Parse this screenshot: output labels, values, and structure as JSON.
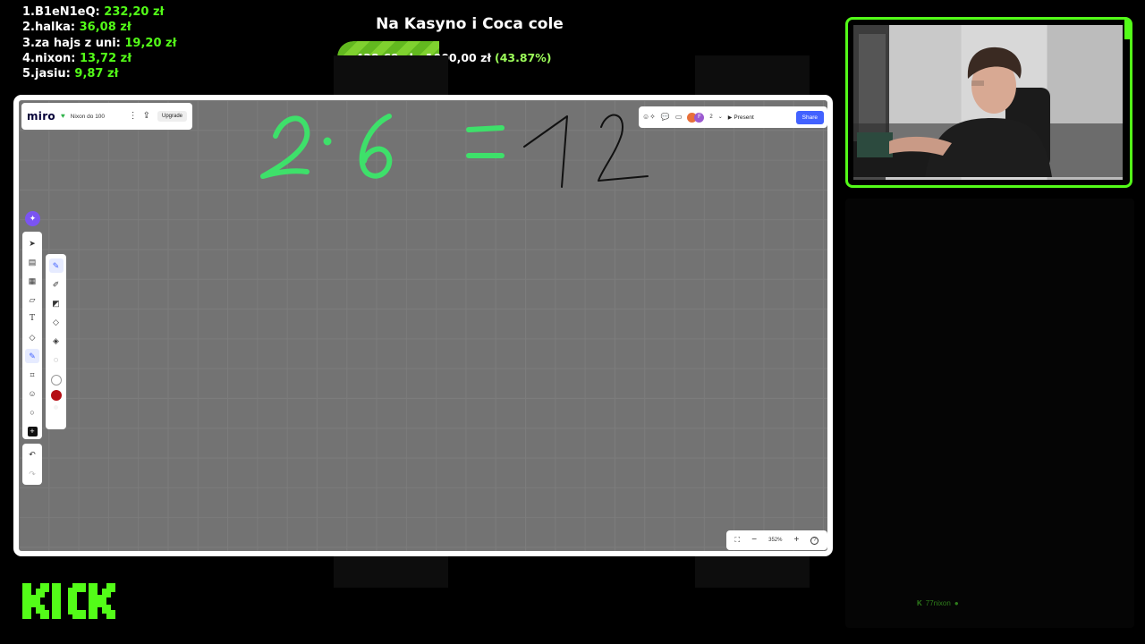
{
  "leaderboard": [
    {
      "rank": "1.",
      "name": "B1eN1eQ:",
      "amount": "232,20 zł"
    },
    {
      "rank": "2.",
      "name": "halka:",
      "amount": "36,08 zł"
    },
    {
      "rank": "3.",
      "name": "za hajs z uni:",
      "amount": "19,20 zł"
    },
    {
      "rank": "4.",
      "name": "nixon:",
      "amount": "13,72 zł"
    },
    {
      "rank": "5.",
      "name": "jasiu:",
      "amount": "9,87 zł"
    }
  ],
  "goal": {
    "title": "Na Kasyno i Coca cole",
    "current": "438,69 zł",
    "separator": "z",
    "target": "1000,00 zł",
    "percent_label": "(43.87%)",
    "progress": 0.4387,
    "fill_color": "#7fd12f"
  },
  "miro": {
    "logo": "miro",
    "board_name": "Nixon do 100",
    "upgrade_label": "Upgrade",
    "avatar_label": "F",
    "collaborator_count": "2",
    "present_label": "Present",
    "share_label": "Share",
    "zoom_level": "352%",
    "handwriting": "2·6 = 12",
    "colors": {
      "accent": "#4262ff",
      "canvas": "#737373",
      "pen_green": "#3ee06a",
      "pen_black": "#111111",
      "selected_color": "#b50f15"
    }
  },
  "brand": {
    "logo_text": "KICK",
    "color": "#53fc18"
  },
  "chat": {
    "handle": "77nixon"
  }
}
